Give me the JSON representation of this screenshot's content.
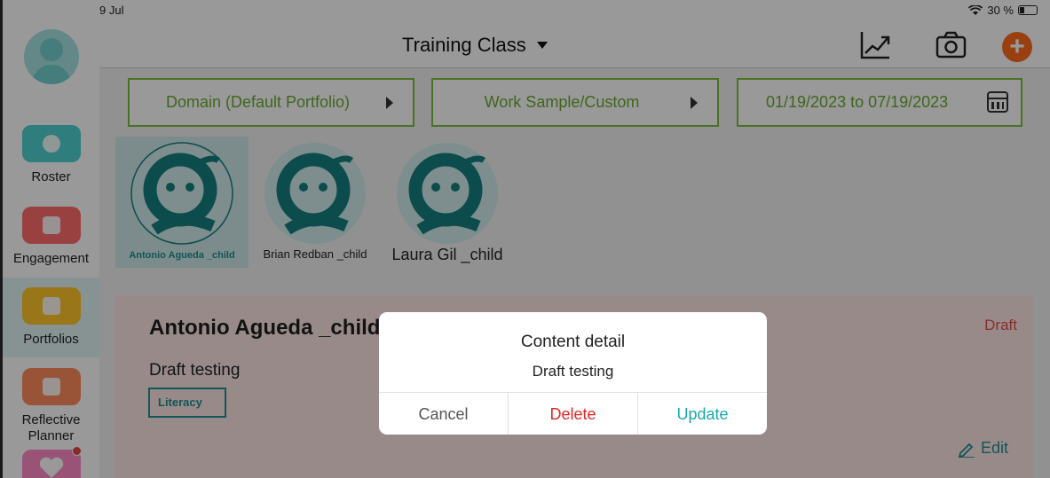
{
  "status_bar": {
    "time": "9 Jul",
    "battery": "30 %"
  },
  "header": {
    "title": "Training Class",
    "icons": [
      "chart-line-icon",
      "camera-icon",
      "plus-icon"
    ],
    "accent": "#ff6b1d"
  },
  "sidebar": {
    "items": [
      {
        "label": "Roster",
        "icon": "roster-icon",
        "color": "#4fd1d0"
      },
      {
        "label": "Engagement",
        "icon": "engagement-icon",
        "color": "#ff6b6b"
      },
      {
        "label": "Portfolios",
        "icon": "portfolios-icon",
        "color": "#ffc629"
      },
      {
        "label": "Reflective\nPlanner",
        "icon": "reflective-planner-icon",
        "color": "#ff8a5c"
      },
      {
        "label": "",
        "icon": "heart-icon",
        "color": "#ff8ac5"
      }
    ]
  },
  "filters": {
    "domain": "Domain (Default Portfolio)",
    "work_sample": "Work Sample/Custom",
    "date_range": "01/19/2023 to 07/19/2023"
  },
  "children": [
    {
      "name": "Antonio Agueda _child",
      "selected": true
    },
    {
      "name": "Brian Redban _child",
      "selected": false
    },
    {
      "name": "Laura Gil _child",
      "selected": false
    }
  ],
  "card": {
    "title": "Antonio Agueda _child",
    "status": "Draft",
    "text": "Draft testing",
    "tag": "Literacy",
    "edit_label": "Edit"
  },
  "dialog": {
    "title": "Content detail",
    "message": "Draft testing",
    "cancel": "Cancel",
    "delete": "Delete",
    "update": "Update"
  }
}
